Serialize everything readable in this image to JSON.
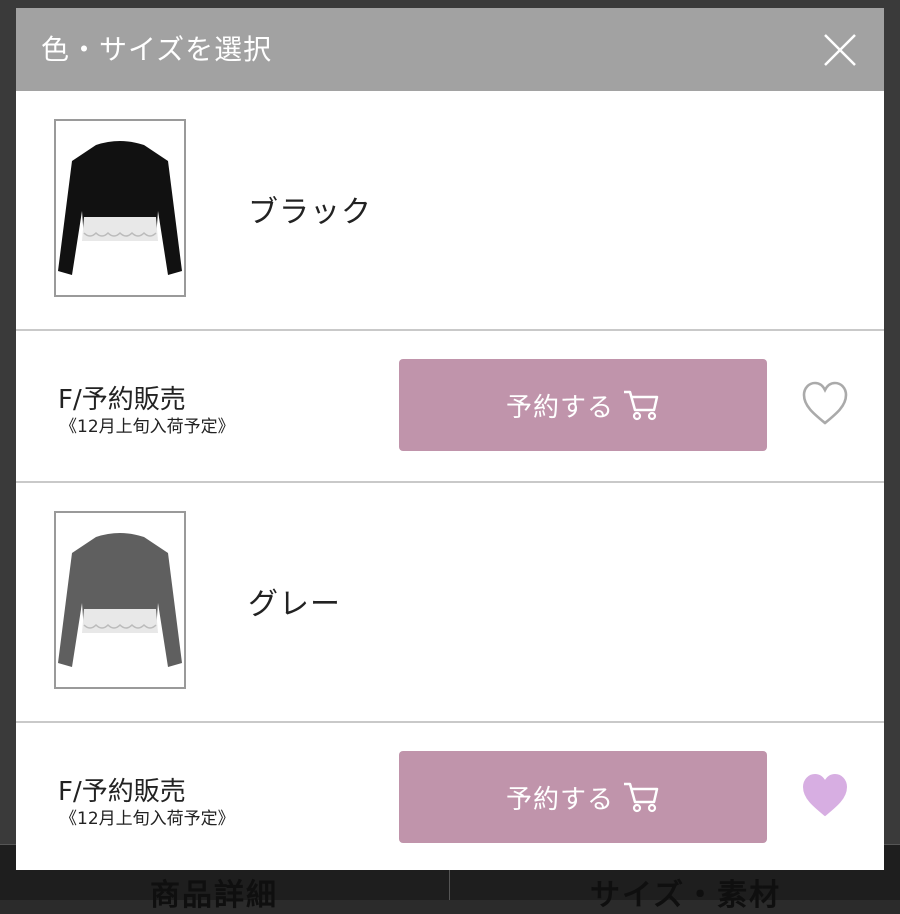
{
  "modal": {
    "title": "色・サイズを選択",
    "close_icon": "close-icon"
  },
  "variants": [
    {
      "color_name": "ブラック",
      "thumb_color": "#111111",
      "size_label": "F/予約販売",
      "arrival_note": "《12月上旬入荷予定》",
      "button_label": "予約する",
      "favorite": false
    },
    {
      "color_name": "グレー",
      "thumb_color": "#5f5f5f",
      "size_label": "F/予約販売",
      "arrival_note": "《12月上旬入荷予定》",
      "button_label": "予約する",
      "favorite": true
    }
  ],
  "background_tabs": [
    "商品詳細",
    "サイズ・素材"
  ],
  "colors": {
    "header_bg": "#a2a2a2",
    "button_bg": "#c094ab",
    "heart_active": "#d7aee2",
    "heart_inactive": "#aaaaaa"
  }
}
